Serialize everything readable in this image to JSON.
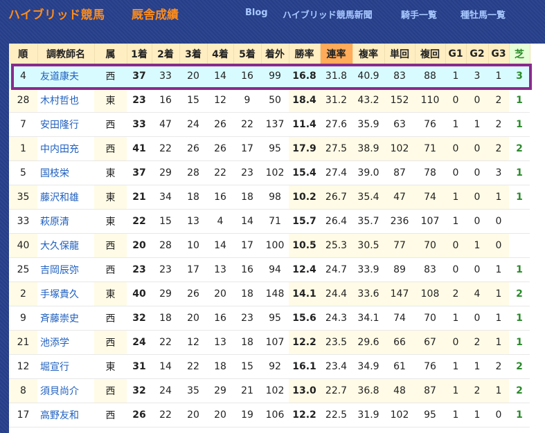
{
  "header": {
    "site_title": "ハイブリッド競馬",
    "page_title": "厩舎成績",
    "nav": [
      "Blog",
      "ハイブリッド競馬新聞",
      "騎手一覧",
      "種牡馬一覧"
    ]
  },
  "table": {
    "columns": [
      "順",
      "調教師名",
      "属",
      "1着",
      "2着",
      "3着",
      "4着",
      "5着",
      "着外",
      "勝率",
      "連率",
      "複率",
      "単回",
      "複回",
      "G1",
      "G2",
      "G3",
      "芝"
    ],
    "rows": [
      [
        "4",
        "友道康夫",
        "西",
        "37",
        "33",
        "20",
        "14",
        "16",
        "99",
        "16.8",
        "31.8",
        "40.9",
        "83",
        "88",
        "1",
        "3",
        "1",
        "3"
      ],
      [
        "28",
        "木村哲也",
        "東",
        "23",
        "16",
        "15",
        "12",
        "9",
        "50",
        "18.4",
        "31.2",
        "43.2",
        "152",
        "110",
        "0",
        "0",
        "2",
        "1"
      ],
      [
        "7",
        "安田隆行",
        "西",
        "33",
        "47",
        "24",
        "26",
        "22",
        "137",
        "11.4",
        "27.6",
        "35.9",
        "63",
        "76",
        "1",
        "1",
        "2",
        "1"
      ],
      [
        "1",
        "中内田充",
        "西",
        "41",
        "22",
        "26",
        "26",
        "17",
        "95",
        "17.9",
        "27.5",
        "38.9",
        "102",
        "71",
        "0",
        "0",
        "2",
        "2"
      ],
      [
        "5",
        "国枝栄",
        "東",
        "37",
        "29",
        "28",
        "22",
        "23",
        "102",
        "15.4",
        "27.4",
        "39.0",
        "87",
        "78",
        "0",
        "0",
        "3",
        "1"
      ],
      [
        "35",
        "藤沢和雄",
        "東",
        "21",
        "34",
        "18",
        "16",
        "18",
        "98",
        "10.2",
        "26.7",
        "35.4",
        "47",
        "74",
        "1",
        "0",
        "1",
        "1"
      ],
      [
        "33",
        "萩原清",
        "東",
        "22",
        "15",
        "13",
        "4",
        "14",
        "71",
        "15.7",
        "26.4",
        "35.7",
        "236",
        "107",
        "1",
        "0",
        "0",
        ""
      ],
      [
        "40",
        "大久保龍",
        "西",
        "20",
        "28",
        "10",
        "14",
        "17",
        "100",
        "10.5",
        "25.3",
        "30.5",
        "77",
        "70",
        "0",
        "1",
        "0",
        ""
      ],
      [
        "25",
        "吉岡辰弥",
        "西",
        "23",
        "23",
        "17",
        "13",
        "16",
        "94",
        "12.4",
        "24.7",
        "33.9",
        "89",
        "83",
        "0",
        "0",
        "1",
        "1"
      ],
      [
        "2",
        "手塚貴久",
        "東",
        "40",
        "29",
        "26",
        "20",
        "18",
        "148",
        "14.1",
        "24.4",
        "33.6",
        "147",
        "108",
        "2",
        "4",
        "1",
        "2"
      ],
      [
        "9",
        "斉藤崇史",
        "西",
        "32",
        "18",
        "20",
        "16",
        "23",
        "95",
        "15.6",
        "24.3",
        "34.1",
        "74",
        "70",
        "1",
        "0",
        "1",
        "1"
      ],
      [
        "21",
        "池添学",
        "西",
        "24",
        "22",
        "12",
        "13",
        "18",
        "107",
        "12.2",
        "23.5",
        "29.6",
        "66",
        "67",
        "0",
        "2",
        "1",
        "1"
      ],
      [
        "12",
        "堀宣行",
        "東",
        "31",
        "14",
        "22",
        "18",
        "15",
        "92",
        "16.1",
        "23.4",
        "34.9",
        "61",
        "76",
        "1",
        "1",
        "2",
        "2"
      ],
      [
        "8",
        "須貝尚介",
        "西",
        "32",
        "24",
        "35",
        "29",
        "21",
        "102",
        "13.0",
        "22.7",
        "36.8",
        "48",
        "87",
        "1",
        "2",
        "1",
        "2"
      ],
      [
        "17",
        "高野友和",
        "西",
        "26",
        "22",
        "20",
        "20",
        "19",
        "106",
        "12.2",
        "22.5",
        "31.9",
        "102",
        "95",
        "1",
        "1",
        "0",
        "1"
      ]
    ]
  },
  "colors": {
    "background": "#27408b",
    "accent_orange": "#ff8c1a",
    "nav": "#a8c8ff",
    "selected_row": "#d8fbff",
    "selected_border": "#8a2a8c",
    "link": "#1e5fbf"
  }
}
